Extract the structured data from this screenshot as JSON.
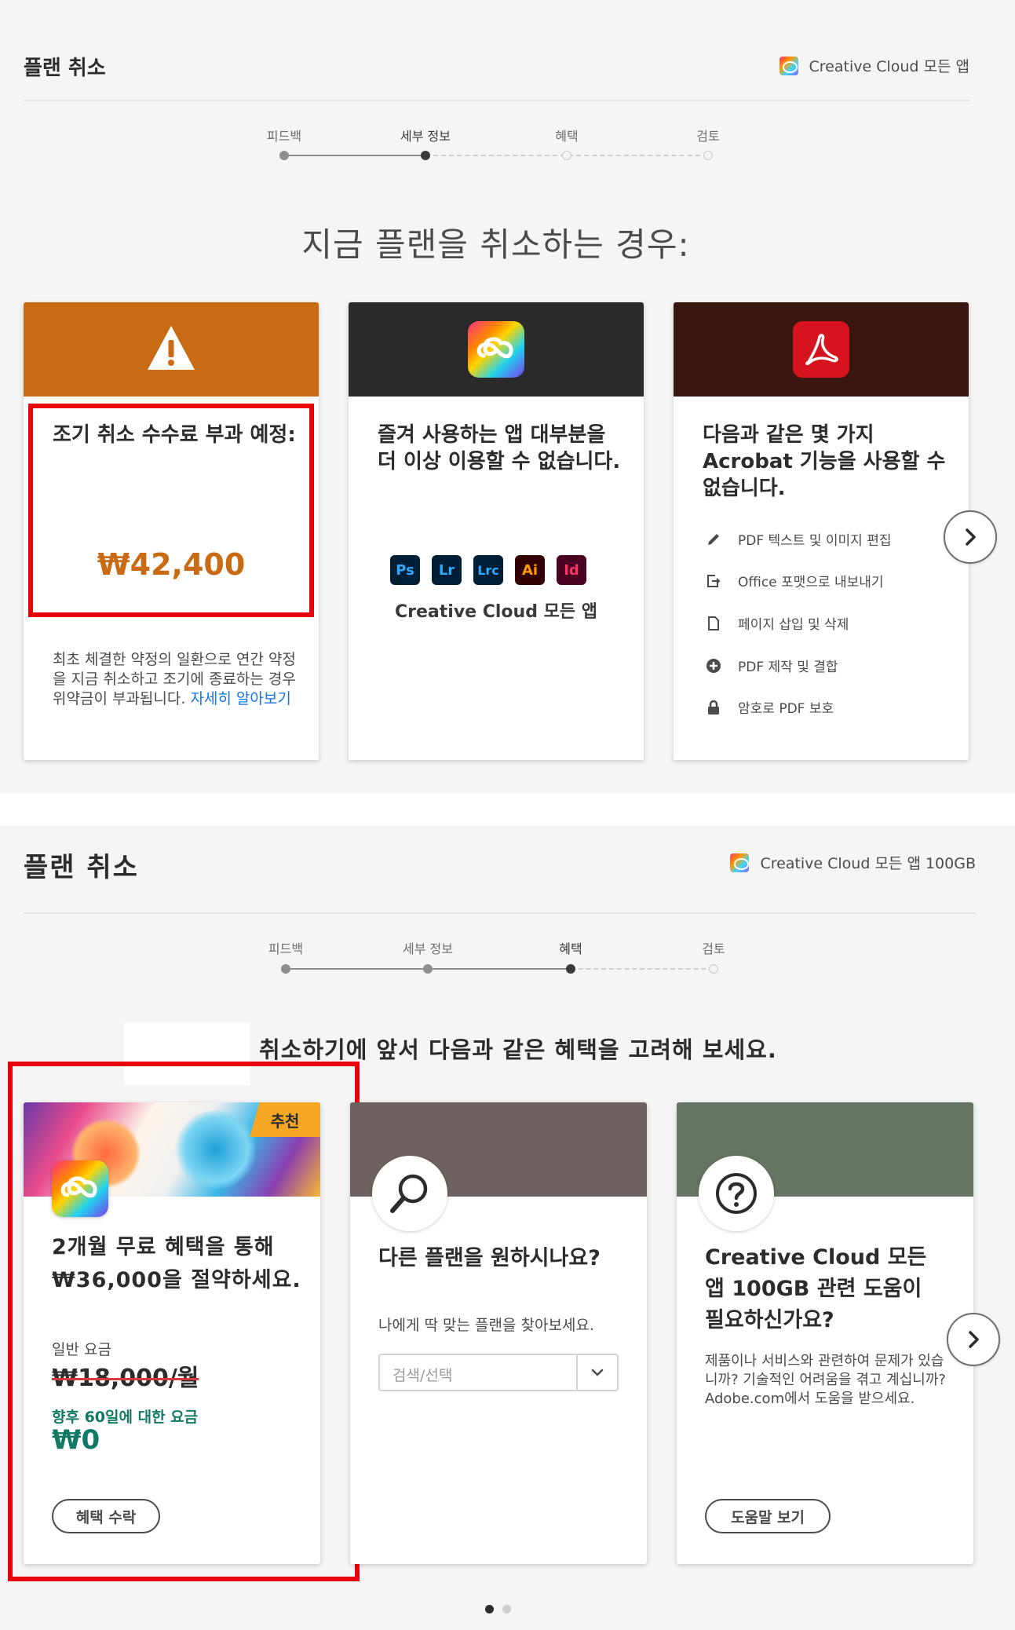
{
  "panel1": {
    "header": {
      "title": "플랜 취소",
      "plan_name": "Creative Cloud 모든 앱"
    },
    "steps": [
      {
        "label": "피드백",
        "state": "done"
      },
      {
        "label": "세부 정보",
        "state": "current"
      },
      {
        "label": "혜택",
        "state": "todo"
      },
      {
        "label": "검토",
        "state": "todo"
      }
    ],
    "heading": "지금 플랜을 취소하는 경우:",
    "cards": {
      "fee": {
        "icon": "warning-icon",
        "header_color": "#c96b14",
        "title": "조기 취소 수수료 부과 예정:",
        "amount": "₩42,400",
        "amount_color": "#c96b14",
        "desc": "최초 체결한 약정의 일환으로 연간 약정을 지금 취소하고 조기에 종료하는 경우 위약금이 부과됩니다. ",
        "link": "자세히 알아보기"
      },
      "apps": {
        "icon": "creative-cloud-icon",
        "header_color": "#2a2a2a",
        "title": "즐겨 사용하는 앱 대부분을 더 이상 이용할 수 없습니다.",
        "app_icons": [
          "Ps",
          "Lr",
          "Lrc",
          "Ai",
          "Id"
        ],
        "caption": "Creative Cloud 모든 앱"
      },
      "acrobat": {
        "icon": "acrobat-icon",
        "header_color": "#3b1510",
        "title": "다음과 같은 몇 가지 Acrobat 기능을 사용할 수 없습니다.",
        "features": [
          {
            "icon": "pencil-icon",
            "label": "PDF 텍스트 및 이미지 편집"
          },
          {
            "icon": "export-icon",
            "label": "Office 포맷으로 내보내기"
          },
          {
            "icon": "page-icon",
            "label": "페이지 삽입 및 삭제"
          },
          {
            "icon": "plus-circle-icon",
            "label": "PDF 제작 및 결합"
          },
          {
            "icon": "lock-icon",
            "label": "암호로 PDF 보호"
          }
        ]
      }
    }
  },
  "panel2": {
    "header": {
      "title": "플랜 취소",
      "plan_name": "Creative Cloud 모든 앱 100GB"
    },
    "steps": [
      {
        "label": "피드백",
        "state": "done"
      },
      {
        "label": "세부 정보",
        "state": "done"
      },
      {
        "label": "혜택",
        "state": "current"
      },
      {
        "label": "검토",
        "state": "todo"
      }
    ],
    "heading": "취소하기에 앞서 다음과 같은 혜택을 고려해 보세요.",
    "cards": {
      "offer": {
        "badge": "추천",
        "title": "2개월 무료 혜택을 통해 ₩36,000을 절약하세요.",
        "regular_label": "일반 요금",
        "regular_price": "₩18,000/월",
        "next_label": "향후 60일에 대한 요금",
        "next_price": "₩0",
        "accent_color": "#117a65",
        "button": "혜택 수락"
      },
      "other_plan": {
        "icon": "search-icon",
        "header_color": "#6e6260",
        "title": "다른 플랜을 원하시나요?",
        "desc": "나에게 딱 맞는 플랜을 찾아보세요.",
        "select_placeholder": "검색/선택"
      },
      "help": {
        "icon": "question-icon",
        "header_color": "#667462",
        "title": "Creative Cloud 모든 앱 100GB 관련 도움이 필요하신가요?",
        "desc": "제품이나 서비스와 관련하여 문제가 있습니까? 기술적인 어려움을 겪고 계십니까? Adobe.com에서 도움을 받으세요.",
        "button": "도움말 보기"
      }
    }
  },
  "colors": {
    "highlight_red": "#e8000f",
    "link_blue": "#1473e6"
  }
}
